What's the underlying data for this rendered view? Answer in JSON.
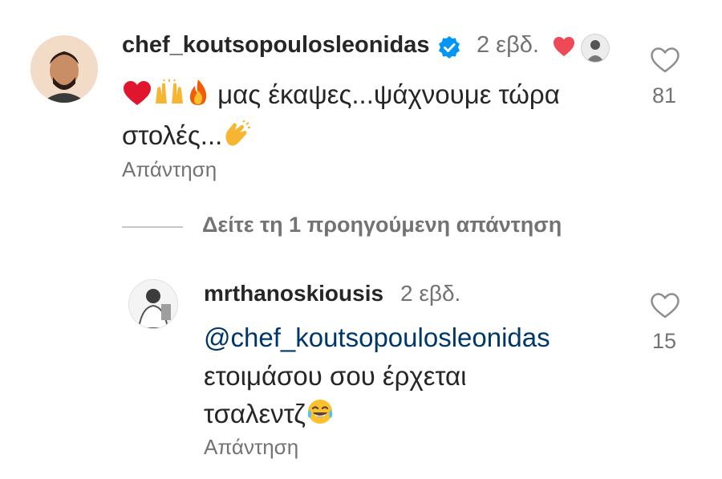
{
  "comment": {
    "username": "chef_koutsopoulosleonidas",
    "time": "2 εβδ.",
    "emoji_icons": [
      "heart-emoji-icon",
      "raising-hands-emoji-icon",
      "fire-emoji-icon"
    ],
    "text_line1": "μας έκαψες...ψάχνουμε τώρα",
    "text_line2": "στολές...",
    "trailing_emoji_icon": "clapping-hands-emoji-icon",
    "reply_label": "Απάντηση",
    "like_count": "81"
  },
  "view_previous": {
    "label": "Δείτε τη 1 προηγούμενη απάντηση"
  },
  "reply": {
    "username": "mrthanoskiousis",
    "time": "2 εβδ.",
    "mention": "@chef_koutsopoulosleonidas",
    "text_line1": "ετοιμάσου σου έρχεται",
    "text_line2": "τσαλεντζ",
    "trailing_emoji_icon": "tears-of-joy-emoji-icon",
    "reply_label": "Απάντηση",
    "like_count": "15"
  },
  "colors": {
    "text": "#262626",
    "secondary": "#737373",
    "mention": "#00376b",
    "verified": "#0095f6",
    "heart": "#ed4956"
  }
}
